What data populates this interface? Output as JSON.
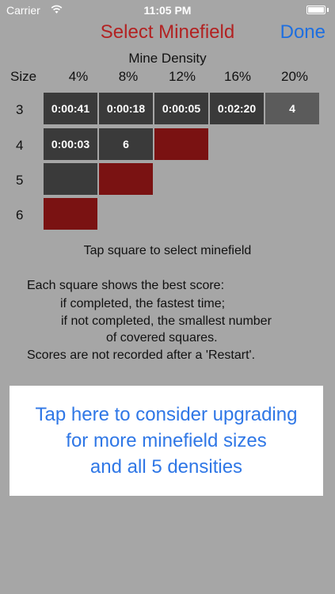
{
  "status": {
    "carrier": "Carrier",
    "time": "11:05 PM"
  },
  "nav": {
    "title": "Select Minefield",
    "done_label": "Done"
  },
  "grid": {
    "density_title": "Mine Density",
    "size_header": "Size",
    "densities": [
      "4%",
      "8%",
      "12%",
      "16%",
      "20%"
    ],
    "rows": [
      {
        "size": "3",
        "cells": [
          {
            "text": "0:00:41",
            "state": "dark"
          },
          {
            "text": "0:00:18",
            "state": "dark"
          },
          {
            "text": "0:00:05",
            "state": "dark"
          },
          {
            "text": "0:02:20",
            "state": "dark"
          },
          {
            "text": "4",
            "state": "mid"
          }
        ]
      },
      {
        "size": "4",
        "cells": [
          {
            "text": "0:00:03",
            "state": "dark"
          },
          {
            "text": "6",
            "state": "dark"
          },
          {
            "text": "",
            "state": "red"
          }
        ]
      },
      {
        "size": "5",
        "cells": [
          {
            "text": "",
            "state": "dark"
          },
          {
            "text": "",
            "state": "red"
          }
        ]
      },
      {
        "size": "6",
        "cells": [
          {
            "text": "",
            "state": "red"
          }
        ]
      }
    ]
  },
  "hint": "Tap square to select minefield",
  "info": {
    "line1": "Each square shows the best score:",
    "line2": "if completed, the fastest time;",
    "line3": "if not completed, the smallest number",
    "line4": "of covered squares.",
    "line5": "Scores are not recorded after a 'Restart'."
  },
  "upgrade": {
    "line1": "Tap here to consider upgrading",
    "line2": "for more minefield sizes",
    "line3": "and all 5 densities"
  },
  "colors": {
    "background": "#a6a6a6",
    "title_red": "#b22222",
    "link_blue": "#1e6fe0",
    "cell_dark": "#3a3a3a",
    "cell_red": "#7a1212",
    "cell_mid": "#5b5b5b"
  },
  "icons": {
    "wifi": "wifi-icon",
    "battery": "battery-icon"
  }
}
